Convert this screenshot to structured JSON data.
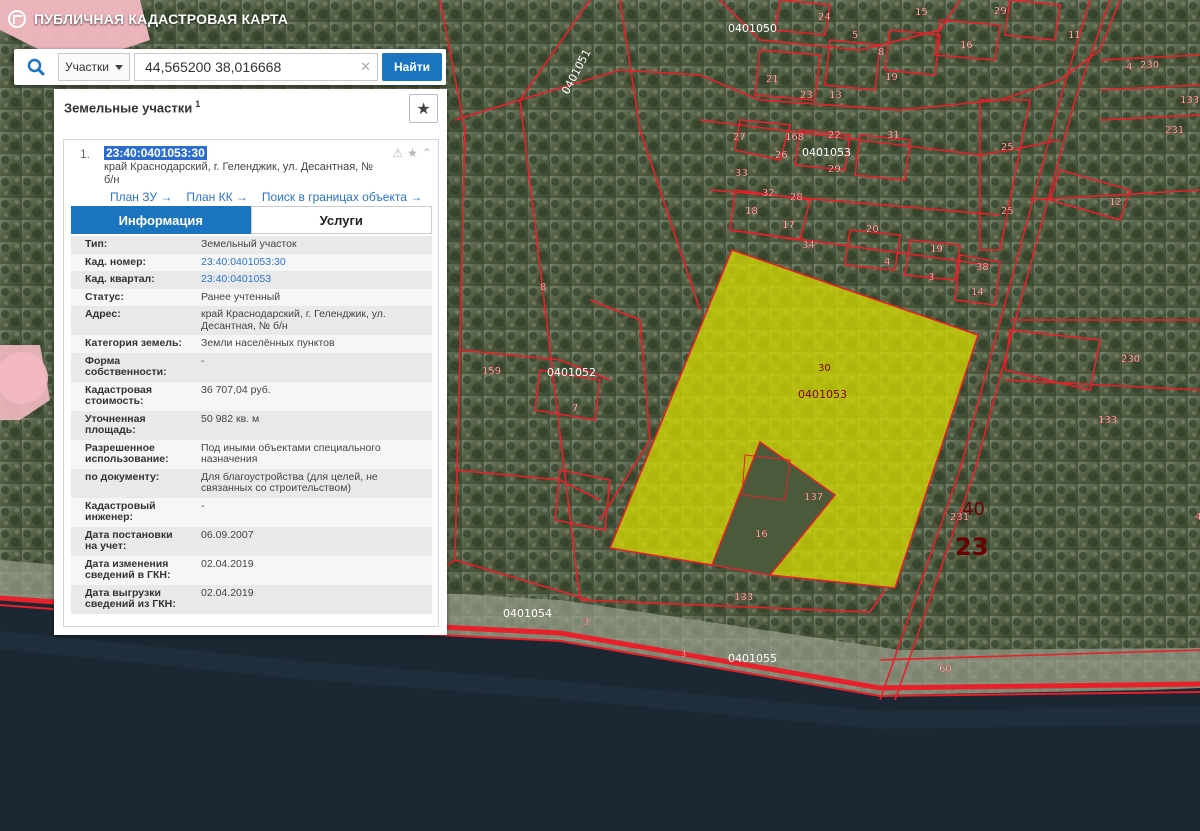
{
  "app": {
    "title": "ПУБЛИЧНАЯ КАДАСТРОВАЯ КАРТА",
    "logo_icon": "pkk-logo"
  },
  "search": {
    "type_label": "Участки",
    "query": "44,565200 38,016668",
    "find_label": "Найти",
    "clear_glyph": "✕"
  },
  "panel": {
    "title": "Земельные участки",
    "count": "1",
    "star_glyph": "★"
  },
  "result": {
    "index": "1.",
    "cadnum": "23:40:0401053:30",
    "address": "край Краснодарский, г. Геленджик, ул. Десантная, № б/н",
    "tool_warn": "⚠",
    "tool_star": "★",
    "tool_collapse": "⌃",
    "links": [
      {
        "label": "План ЗУ →"
      },
      {
        "label": "План КК →"
      },
      {
        "label": "Поиск в границах объекта →"
      }
    ]
  },
  "tabs": [
    {
      "label": "Информация",
      "active": true
    },
    {
      "label": "Услуги",
      "active": false
    }
  ],
  "info": [
    {
      "key": "Тип:",
      "value": "Земельный участок"
    },
    {
      "key": "Кад. номер:",
      "value": "23:40:0401053:30",
      "link": true
    },
    {
      "key": "Кад. квартал:",
      "value": "23:40:0401053",
      "link": true
    },
    {
      "key": "Статус:",
      "value": "Ранее учтенный"
    },
    {
      "key": "Адрес:",
      "value": "край Краснодарский, г. Геленджик, ул. Десантная, № б/н"
    },
    {
      "key": "Категория земель:",
      "value": "Земли населённых пунктов"
    },
    {
      "key": "Форма собственности:",
      "value": "-"
    },
    {
      "key": "Кадастровая стоимость:",
      "value": "36 707,04 руб."
    },
    {
      "key": "Уточненная площадь:",
      "value": "50 982 кв. м"
    },
    {
      "key": "Разрешенное использование:",
      "value": "Под иными объектами специального назначения"
    },
    {
      "key": "по документу:",
      "value": "Для благоустройства (для целей, не связанных со строительством)"
    },
    {
      "key": "Кадастровый инженер:",
      "value": "-"
    },
    {
      "key": "Дата постановки на учет:",
      "value": "06.09.2007"
    },
    {
      "key": "Дата изменения сведений в ГКН:",
      "value": "02.04.2019"
    },
    {
      "key": "Дата выгрузки сведений из ГКН:",
      "value": "02.04.2019"
    }
  ],
  "map": {
    "colors": {
      "boundary": "#e8202a",
      "selected_fill": "#d7dc00",
      "land": "#5a6a4a",
      "sea": "#1b2733"
    },
    "selected_plot": {
      "number": "30",
      "quarter": "0401053"
    },
    "quarter_labels": [
      "0401050",
      "0401051",
      "0401052",
      "0401053",
      "0401054",
      "0401055"
    ],
    "district_labels": [
      "40",
      "23"
    ],
    "plot_numbers": [
      "24",
      "15",
      "16",
      "5",
      "11",
      "4",
      "29",
      "8",
      "19",
      "27",
      "21",
      "23",
      "22",
      "13",
      "26",
      "168",
      "29",
      "31",
      "33",
      "32",
      "28",
      "18",
      "17",
      "34",
      "20",
      "4",
      "3",
      "19",
      "14",
      "38",
      "25",
      "25",
      "12",
      "230",
      "133",
      "231",
      "159",
      "7",
      "8",
      "137",
      "16",
      "133",
      "3",
      "3",
      "60",
      "231",
      "40",
      "230",
      "133"
    ]
  }
}
